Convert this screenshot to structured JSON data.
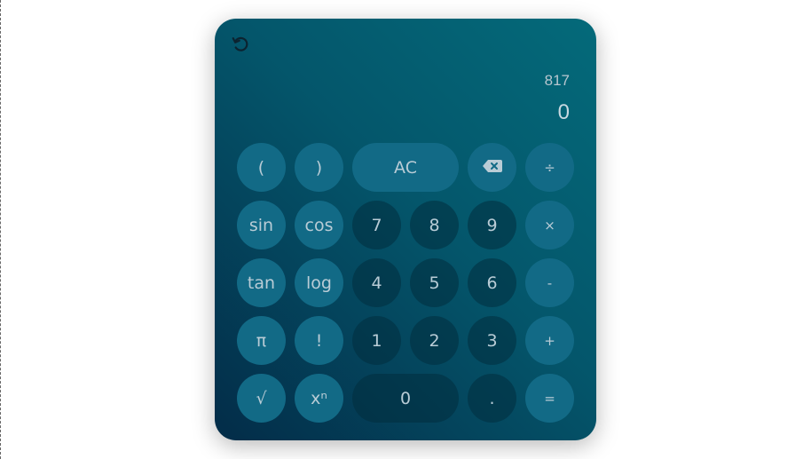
{
  "display": {
    "expression": "817",
    "result": "0"
  },
  "icons": {
    "history": "history-undo-icon",
    "backspace": "backspace-icon"
  },
  "colors": {
    "panel_top": "#046a7a",
    "panel_bottom": "#032c48",
    "function_key": "#126a86",
    "number_key": "#02303f",
    "key_text": "#b9ccd6"
  },
  "keys": {
    "open_paren": "(",
    "close_paren": ")",
    "clear": "AC",
    "divide": "÷",
    "sin": "sin",
    "cos": "cos",
    "seven": "7",
    "eight": "8",
    "nine": "9",
    "multiply": "×",
    "tan": "tan",
    "log": "log",
    "four": "4",
    "five": "5",
    "six": "6",
    "minus": "-",
    "pi": "π",
    "factorial": "!",
    "one": "1",
    "two": "2",
    "three": "3",
    "plus": "+",
    "sqrt": "√",
    "power": "xⁿ",
    "zero": "0",
    "decimal": ".",
    "equals": "="
  }
}
